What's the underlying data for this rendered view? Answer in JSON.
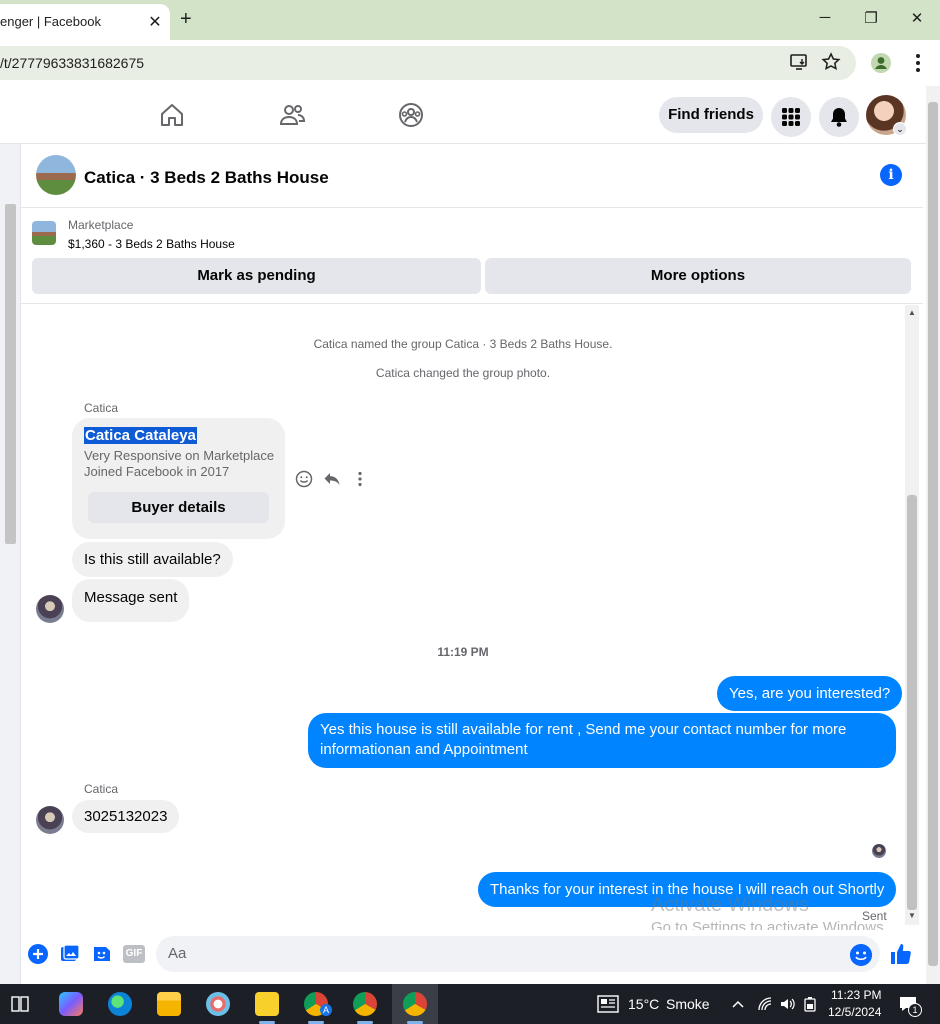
{
  "browser": {
    "tab_title": "enger | Facebook",
    "tab_close": "✕",
    "new_tab": "+",
    "url": "/t/27779633831682675",
    "minimize": "─",
    "restore": "❐",
    "close": "✕"
  },
  "header": {
    "find_friends": "Find friends",
    "avatar_caret": "⌄"
  },
  "conversation": {
    "title": "Catica · 3 Beds 2 Baths House",
    "info_glyph": "i"
  },
  "marketplace": {
    "label": "Marketplace",
    "listing": "$1,360 - 3 Beds 2 Baths House",
    "mark_pending": "Mark as pending",
    "more_options": "More options"
  },
  "messages": {
    "system": [
      "Catica named the group Catica · 3 Beds 2 Baths House.",
      "Catica changed the group photo."
    ],
    "sender_name": "Catica",
    "card": {
      "name": "Catica Cataleya",
      "line1": "Very Responsive on Marketplace",
      "line2": "Joined Facebook in 2017",
      "button": "Buyer details"
    },
    "incoming_1": "Is this still available?",
    "incoming_2": "Message sent",
    "timestamp": "11:19 PM",
    "outgoing_1": "Yes, are you interested?",
    "outgoing_2_line1": "Yes this house is still available for rent , Send me your contact number for more",
    "outgoing_2_line2": "informationan and Appointment",
    "incoming_3": "3025132023",
    "outgoing_3": "Thanks for your interest in the house I will reach out Shortly",
    "status": "Sent"
  },
  "watermark": {
    "line1": "Activate Windows",
    "line2": "Go to Settings to activate Windows."
  },
  "composer": {
    "placeholder": "Aa",
    "gif_label": "GIF"
  },
  "taskbar": {
    "weather_temp": "15°C",
    "weather_desc": "Smoke",
    "time": "11:23 PM",
    "date": "12/5/2024",
    "notification_count": "1",
    "chrome_badge": "A"
  },
  "colors": {
    "messenger_blue": "#0084ff",
    "fb_blue": "#0866ff",
    "bubble_gray": "#f0f0f0",
    "chrome_frame": "#d3e3c8"
  }
}
